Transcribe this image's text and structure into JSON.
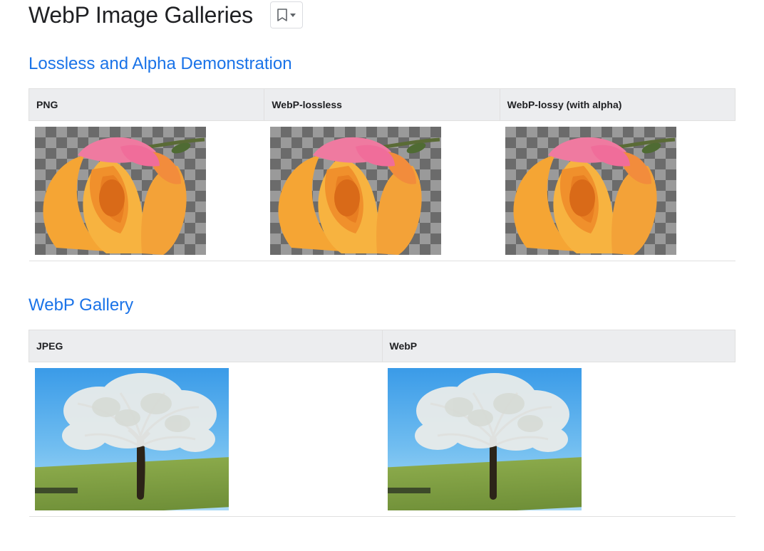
{
  "title": "WebP Image Galleries",
  "bookmark_icon": "bookmark-icon",
  "sections": {
    "alpha": {
      "heading": "Lossless and Alpha Demonstration",
      "columns": {
        "png": "PNG",
        "webp_lossless": "WebP-lossless",
        "webp_lossy_alpha": "WebP-lossy (with alpha)"
      },
      "image": {
        "subject": "orange-rose-with-alpha",
        "background": "transparency-checkerboard"
      }
    },
    "gallery": {
      "heading": "WebP Gallery",
      "columns": {
        "jpeg": "JPEG",
        "webp": "WebP"
      },
      "image": {
        "subject": "blossoming-tree-on-hill",
        "background": "blue-sky"
      }
    }
  }
}
